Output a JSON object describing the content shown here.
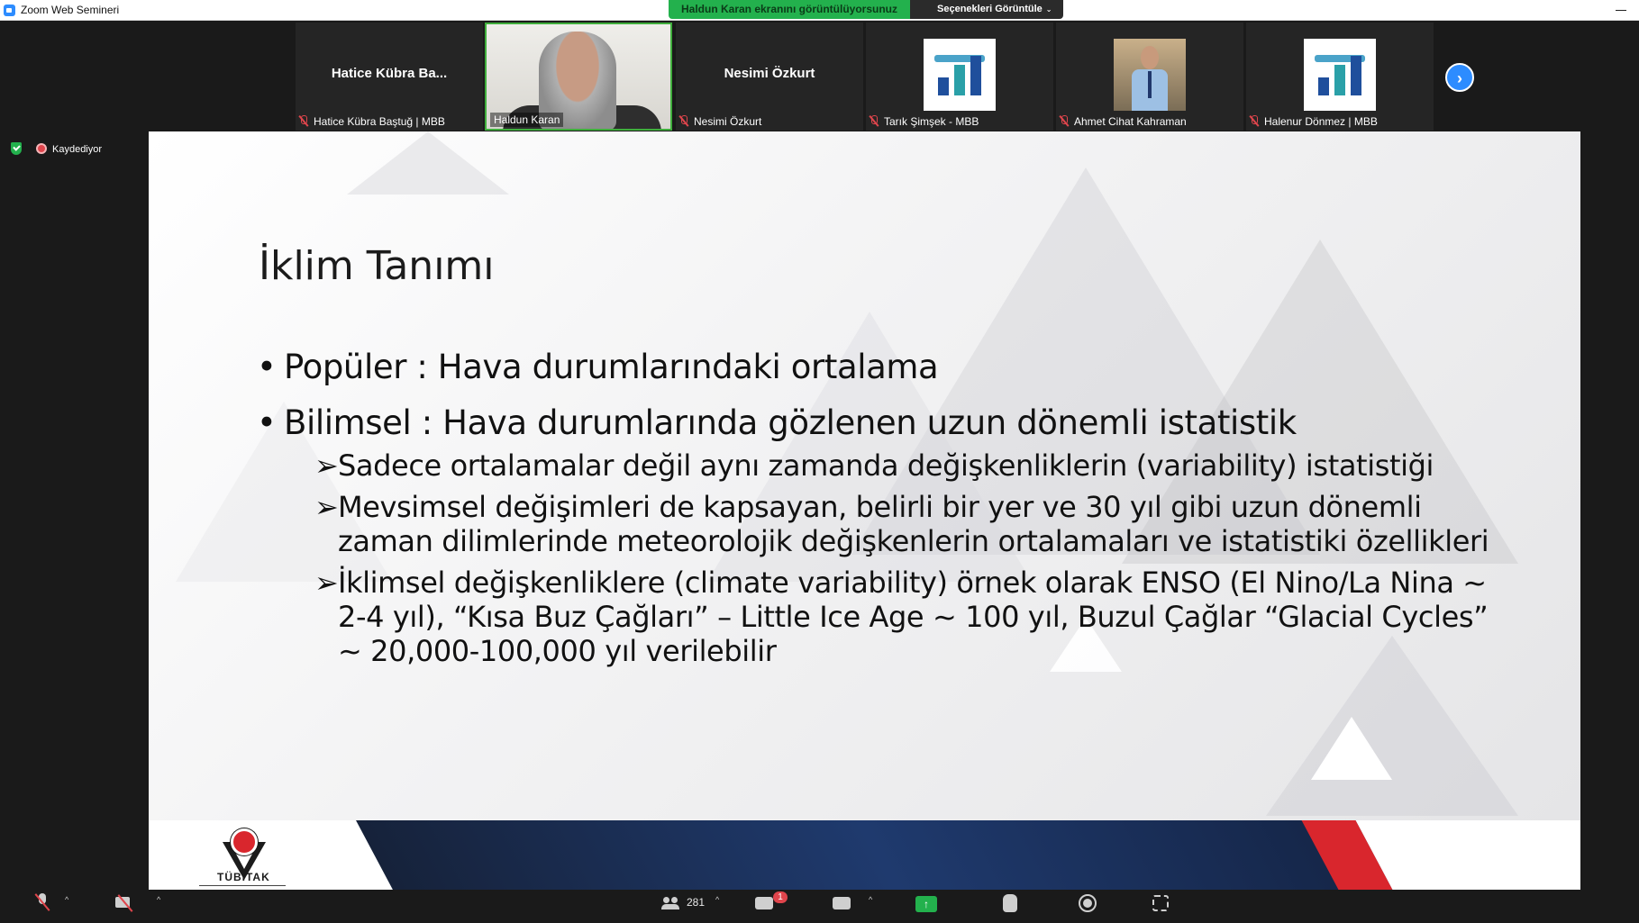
{
  "window": {
    "title": "Zoom Web Semineri",
    "share_banner": "Haldun Karan ekranını görüntülüyorsunuz",
    "view_options": "Seçenekleri Görüntüle"
  },
  "participants": [
    {
      "display_name": "Hatice Kübra Ba...",
      "label": "Hatice Kübra Baştuğ | MBB",
      "video": "none",
      "muted": true
    },
    {
      "display_name": "",
      "label": "Haldun Karan",
      "video": "camera",
      "muted": false,
      "active_speaker": true
    },
    {
      "display_name": "Nesimi Özkurt",
      "label": "Nesimi Özkurt",
      "video": "none",
      "muted": true
    },
    {
      "display_name": "",
      "label": "Tarık Şimşek - MBB",
      "video": "logo",
      "muted": true
    },
    {
      "display_name": "",
      "label": "Ahmet Cihat Kahraman",
      "video": "photo",
      "muted": true
    },
    {
      "display_name": "",
      "label": "Halenur Dönmez | MBB",
      "video": "logo",
      "muted": true
    }
  ],
  "status": {
    "recording": "Kaydediyor"
  },
  "slide": {
    "title": "İklim Tanımı",
    "bullets": [
      "Popüler : Hava durumlarındaki ortalama",
      "Bilimsel : Hava durumlarında gözlenen uzun dönemli istatistik"
    ],
    "subbullets": [
      "Sadece ortalamalar değil aynı zamanda değişkenliklerin (variability) istatistiği",
      "Mevsimsel değişimleri de kapsayan, belirli bir yer ve 30 yıl gibi uzun dönemli zaman dilimlerinde meteorolojik değişkenlerin ortalamaları ve istatistiki özellikleri",
      "İklimsel değişkenliklere (climate variability) örnek olarak ENSO (El Nino/La Nina ~ 2-4 yıl), “Kısa Buz Çağları” – Little Ice Age ~ 100 yıl, Buzul Çağlar “Glacial Cycles” ~ 20,000-100,000 yıl verilebilir"
    ],
    "logo_text": "TÜBİTAK"
  },
  "toolbar": {
    "participant_count": "281",
    "qa_badge": "1",
    "icons": [
      "mic-muted-icon",
      "camera-off-icon",
      "participants-icon",
      "qa-icon",
      "chat-icon",
      "share-screen-icon",
      "raise-hand-icon",
      "record-icon",
      "focus-icon"
    ]
  },
  "colors": {
    "share_green": "#23b14d",
    "zoom_blue": "#2d8cff",
    "mute_red": "#e0454c",
    "tubitak_red": "#d9262d",
    "tubitak_navy": "#1f3a6e"
  }
}
